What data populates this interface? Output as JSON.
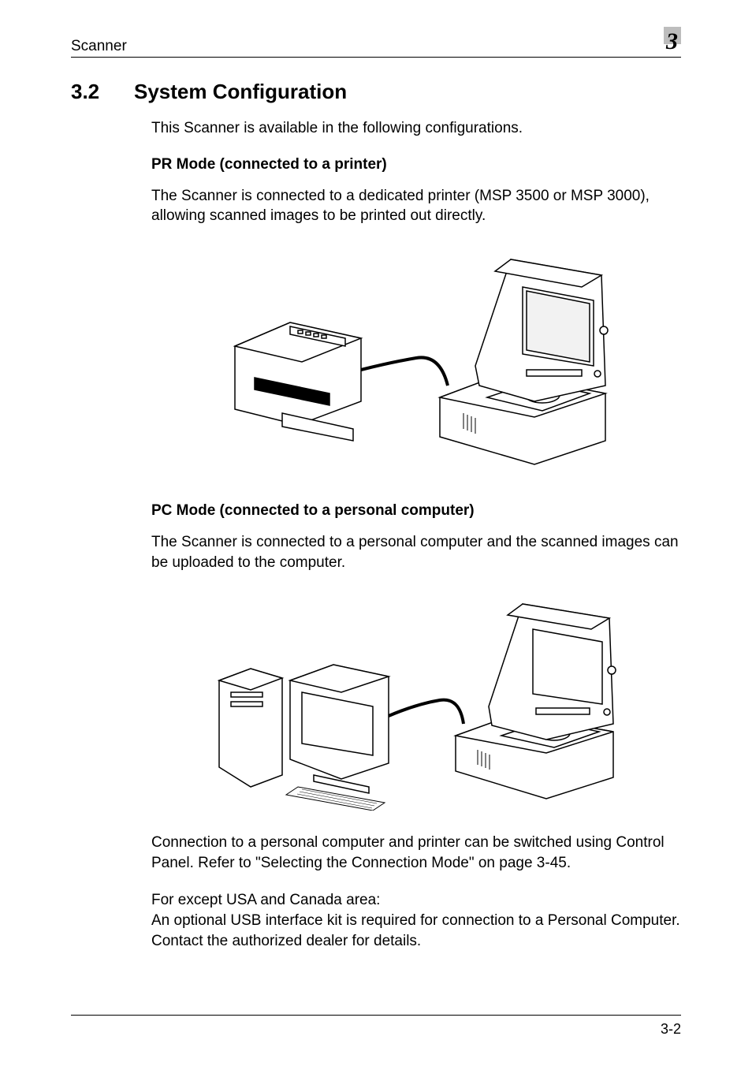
{
  "header": {
    "left": "Scanner",
    "chapter": "3"
  },
  "section": {
    "number": "3.2",
    "title": "System Configuration"
  },
  "intro": "This Scanner is available in the following configurations.",
  "pr_mode": {
    "heading": "PR Mode (connected to a printer)",
    "text": "The Scanner is connected to a dedicated printer (MSP 3500 or MSP 3000), allowing scanned images to be printed out directly."
  },
  "pc_mode": {
    "heading": "PC Mode (connected to a personal computer)",
    "text": "The Scanner is connected to a personal computer and the scanned images can be uploaded to the computer."
  },
  "connection_note": "Connection to a personal computer and printer can be switched using Control Panel. Refer to \"Selecting the Connection Mode\" on page 3-45.",
  "region_note": "For except USA and Canada area:\nAn optional USB interface kit is required for connection to a Personal Computer. Contact the authorized dealer for details.",
  "footer": {
    "page": "3-2"
  }
}
